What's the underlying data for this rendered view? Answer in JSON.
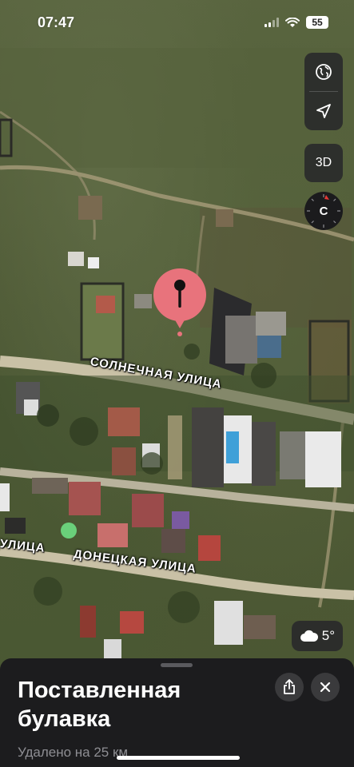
{
  "status_bar": {
    "time": "07:47",
    "battery": "55"
  },
  "map_controls": {
    "map_mode_icon": "globe-icon",
    "location_icon": "location-arrow-icon",
    "mode_3d_label": "3D",
    "compass_label": "C"
  },
  "streets": {
    "solnechnaya": "СОЛНЕЧНАЯ УЛИЦА",
    "donetskaya": "ДОНЕЦКАЯ УЛИЦА",
    "partial_left": "УЛИЦА"
  },
  "weather": {
    "icon": "cloud-icon",
    "temperature": "5°"
  },
  "place_card": {
    "title": "Поставленная булавка",
    "distance": "Удалено на 25 км",
    "share_icon": "share-icon",
    "close_icon": "close-icon"
  },
  "colors": {
    "pin": "#e8737c",
    "sheet_bg": "#1c1c1e",
    "control_bg": "#28282a",
    "compass_red": "#e53935"
  }
}
